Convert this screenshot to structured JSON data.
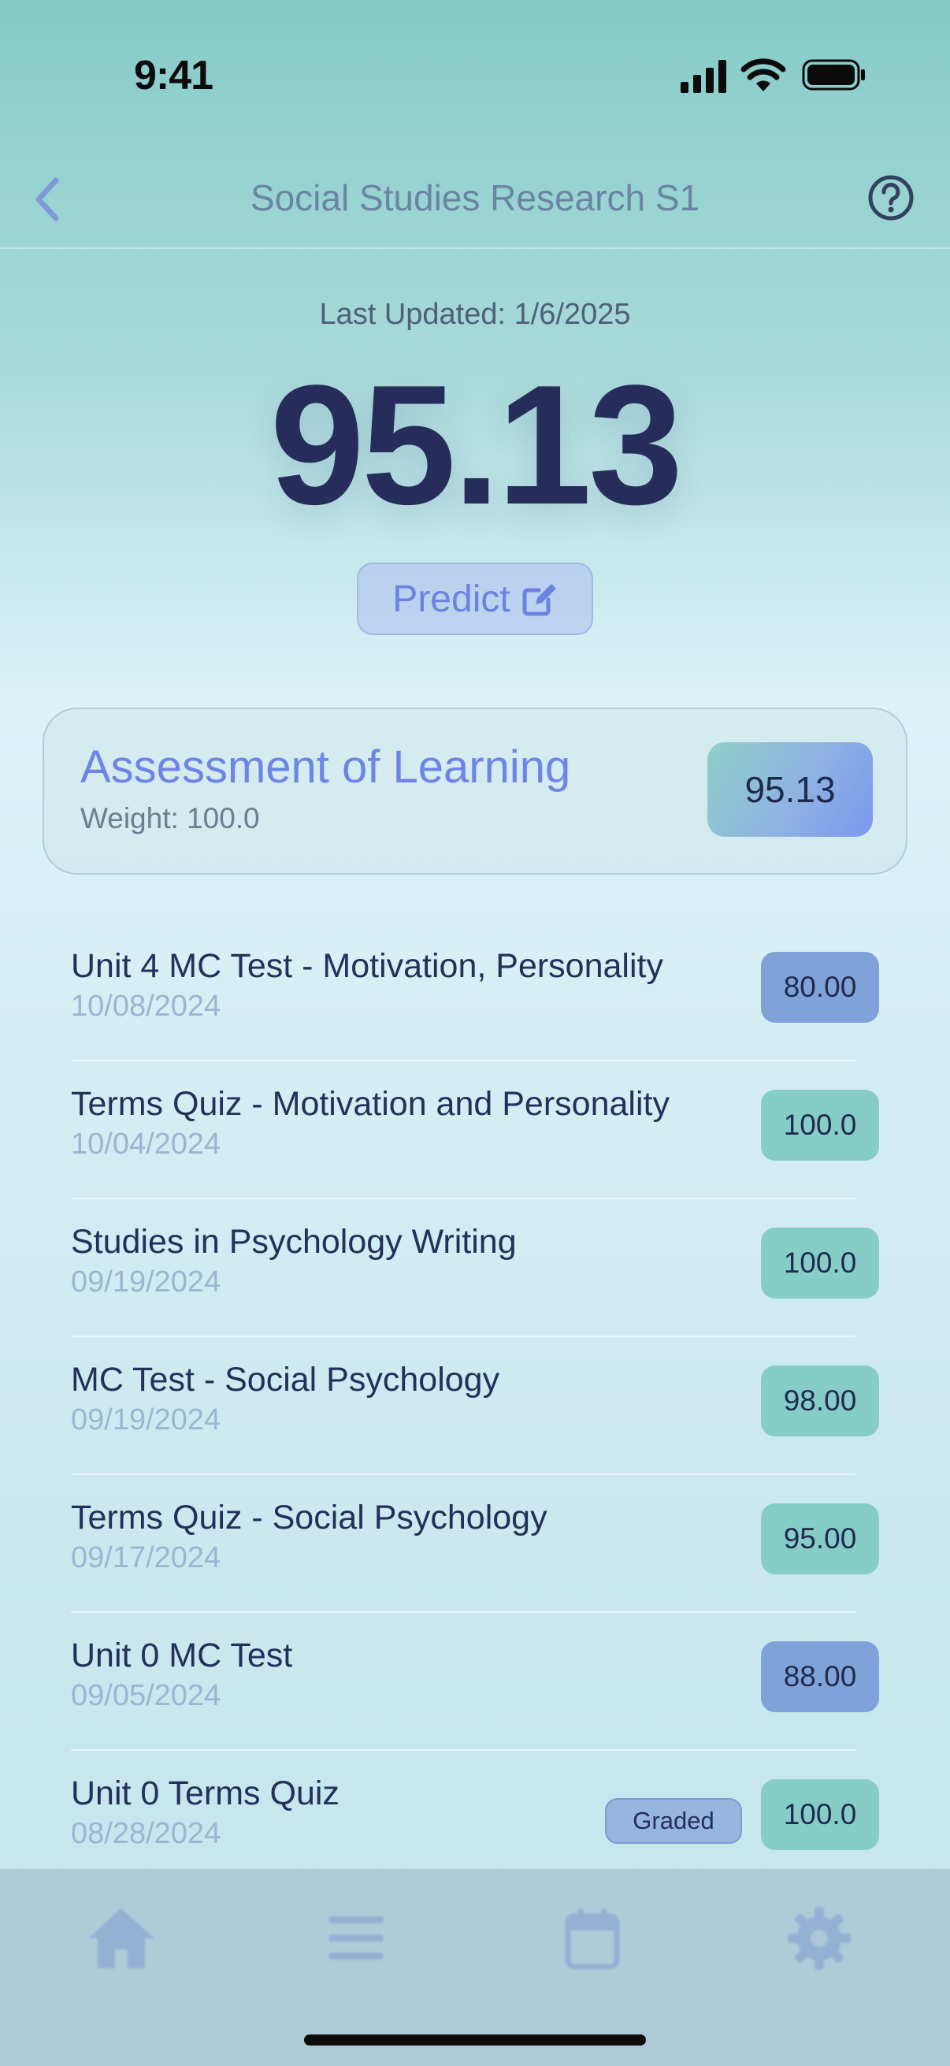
{
  "status_bar": {
    "time": "9:41"
  },
  "nav": {
    "title": "Social Studies Research S1",
    "back_icon": "chevron-left-icon",
    "help_icon": "question-circle-icon"
  },
  "summary": {
    "last_updated": "Last Updated: 1/6/2025",
    "grade": "95.13",
    "predict_label": "Predict"
  },
  "category": {
    "name": "Assessment of Learning",
    "weight": "Weight: 100.0",
    "grade": "95.13"
  },
  "assignments": [
    {
      "title": "Unit 4 MC Test - Motivation, Personality",
      "date": "10/08/2024",
      "score": "80.00",
      "color": "#7fa3d8"
    },
    {
      "title": "Terms Quiz - Motivation and Personality",
      "date": "10/04/2024",
      "score": "100.0",
      "color": "#86cdc8"
    },
    {
      "title": "Studies in Psychology Writing",
      "date": "09/19/2024",
      "score": "100.0",
      "color": "#86cdc8"
    },
    {
      "title": "MC Test - Social Psychology",
      "date": "09/19/2024",
      "score": "98.00",
      "color": "#86cdc8"
    },
    {
      "title": "Terms Quiz - Social Psychology",
      "date": "09/17/2024",
      "score": "95.00",
      "color": "#86cdc8"
    },
    {
      "title": "Unit 0 MC Test",
      "date": "09/05/2024",
      "score": "88.00",
      "color": "#7fa3d8"
    },
    {
      "title": "Unit 0 Terms Quiz",
      "date": "08/28/2024",
      "score": "100.0",
      "color": "#86cdc8",
      "badge": "Graded"
    }
  ],
  "tab_bar": {
    "tabs": [
      "home-icon",
      "list-icon",
      "calendar-icon",
      "gear-icon"
    ]
  },
  "colors": {
    "accent": "#6c85e6",
    "grade_text": "#262d5a",
    "score_blue": "#7fa3d8",
    "score_teal": "#86cdc8"
  }
}
